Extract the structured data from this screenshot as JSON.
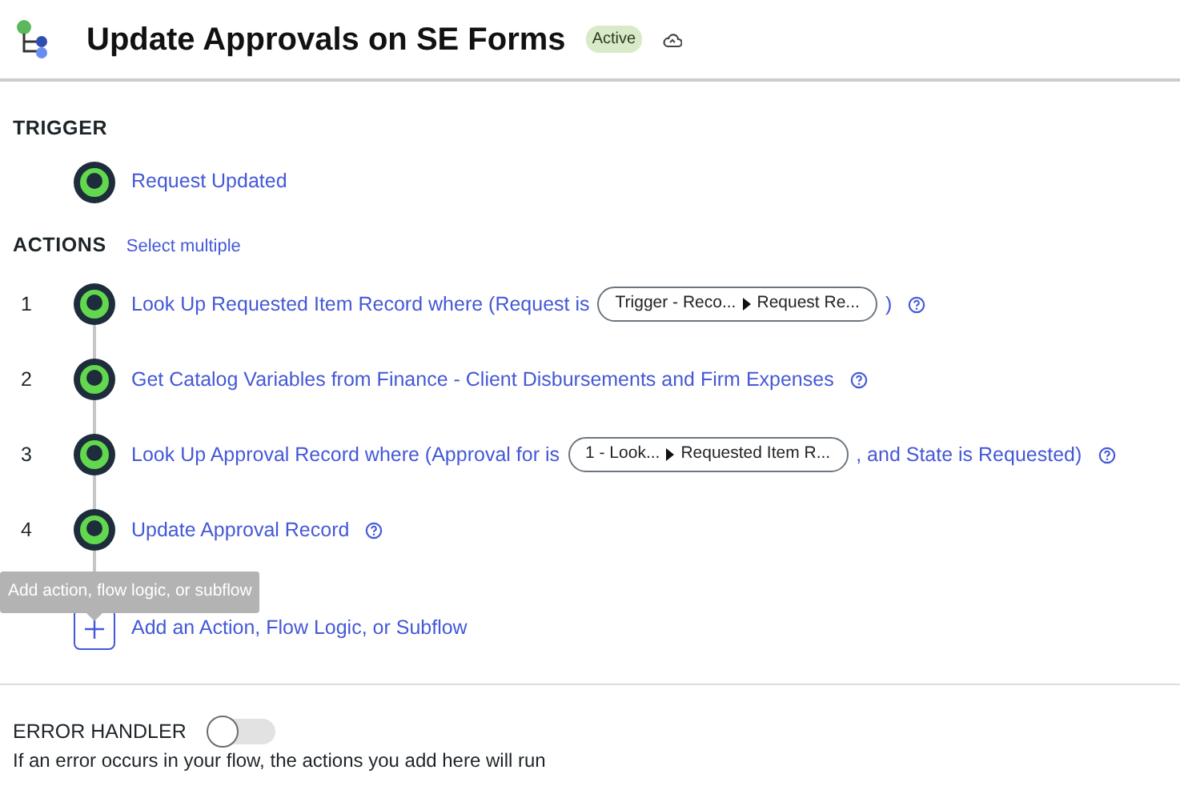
{
  "header": {
    "title": "Update Approvals on SE Forms",
    "status_badge": "Active"
  },
  "trigger": {
    "heading": "TRIGGER",
    "label": "Request Updated"
  },
  "actions": {
    "heading": "ACTIONS",
    "select_link": "Select multiple",
    "steps": [
      {
        "number": "1",
        "parts": [
          {
            "kind": "text",
            "text": "Look Up Requested Item Record where (Request is"
          },
          {
            "kind": "pill",
            "from": "Trigger - Reco...",
            "to": "Request Re..."
          },
          {
            "kind": "text",
            "text": ")"
          }
        ]
      },
      {
        "number": "2",
        "parts": [
          {
            "kind": "text",
            "text": "Get Catalog Variables from Finance - Client Disbursements and Firm Expenses"
          }
        ]
      },
      {
        "number": "3",
        "parts": [
          {
            "kind": "text",
            "text": "Look Up Approval Record where (Approval for is"
          },
          {
            "kind": "pill",
            "from": "1 - Look...",
            "to": "Requested Item R..."
          },
          {
            "kind": "text",
            "text": ", and State is Requested)"
          }
        ]
      },
      {
        "number": "4",
        "parts": [
          {
            "kind": "text",
            "text": "Update Approval Record"
          }
        ]
      }
    ],
    "tooltip": "Add action, flow logic, or subflow",
    "add_label": "Add an Action, Flow Logic, or Subflow"
  },
  "error_handler": {
    "label": "ERROR HANDLER",
    "on": false,
    "description": "If an error occurs in your flow, the actions you add here will run"
  }
}
